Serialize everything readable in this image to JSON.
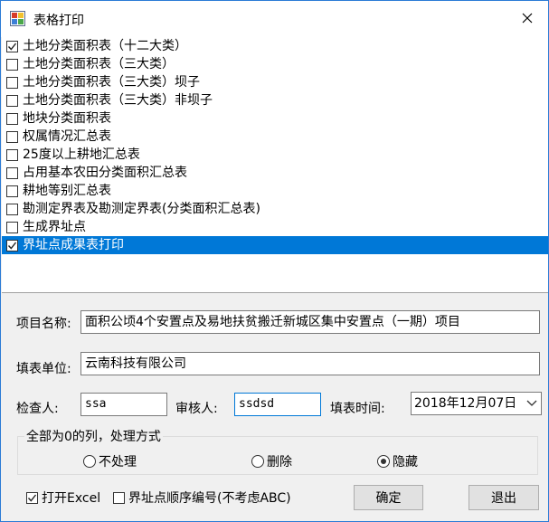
{
  "window": {
    "title": "表格打印"
  },
  "list": {
    "items": [
      {
        "label": "土地分类面积表（十二大类）",
        "checked": true,
        "selected": false
      },
      {
        "label": "土地分类面积表（三大类）",
        "checked": false,
        "selected": false
      },
      {
        "label": "土地分类面积表（三大类）坝子",
        "checked": false,
        "selected": false
      },
      {
        "label": "土地分类面积表（三大类）非坝子",
        "checked": false,
        "selected": false
      },
      {
        "label": "地块分类面积表",
        "checked": false,
        "selected": false
      },
      {
        "label": "权属情况汇总表",
        "checked": false,
        "selected": false
      },
      {
        "label": "25度以上耕地汇总表",
        "checked": false,
        "selected": false
      },
      {
        "label": "占用基本农田分类面积汇总表",
        "checked": false,
        "selected": false
      },
      {
        "label": "耕地等别汇总表",
        "checked": false,
        "selected": false
      },
      {
        "label": "勘测定界表及勘测定界表(分类面积汇总表)",
        "checked": false,
        "selected": false
      },
      {
        "label": "生成界址点",
        "checked": false,
        "selected": false
      },
      {
        "label": "界址点成果表打印",
        "checked": true,
        "selected": true
      }
    ]
  },
  "form": {
    "project_name_label": "项目名称:",
    "project_name_value": "面积公顷4个安置点及易地扶贫搬迁新城区集中安置点（一期）项目",
    "unit_label": "填表单位:",
    "unit_value": "云南科技有限公司",
    "checker_label": "检查人:",
    "checker_value": "ssa",
    "reviewer_label": "审核人:",
    "reviewer_value": "ssdsd",
    "date_label": "填表时间:",
    "date_value": "2018年12月07日"
  },
  "zero_columns": {
    "title": "全部为0的列，处理方式",
    "options": [
      "不处理",
      "删除",
      "隐藏"
    ],
    "selected": "隐藏"
  },
  "options": {
    "open_excel_label": "打开Excel",
    "open_excel_checked": true,
    "sequential_label": "界址点顺序编号(不考虑ABC)",
    "sequential_checked": false
  },
  "buttons": {
    "ok": "确定",
    "exit": "退出"
  },
  "colors": {
    "selection": "#0078d7",
    "window_border": "#2b7bd6",
    "dialog_bg": "#f0f0f0"
  }
}
